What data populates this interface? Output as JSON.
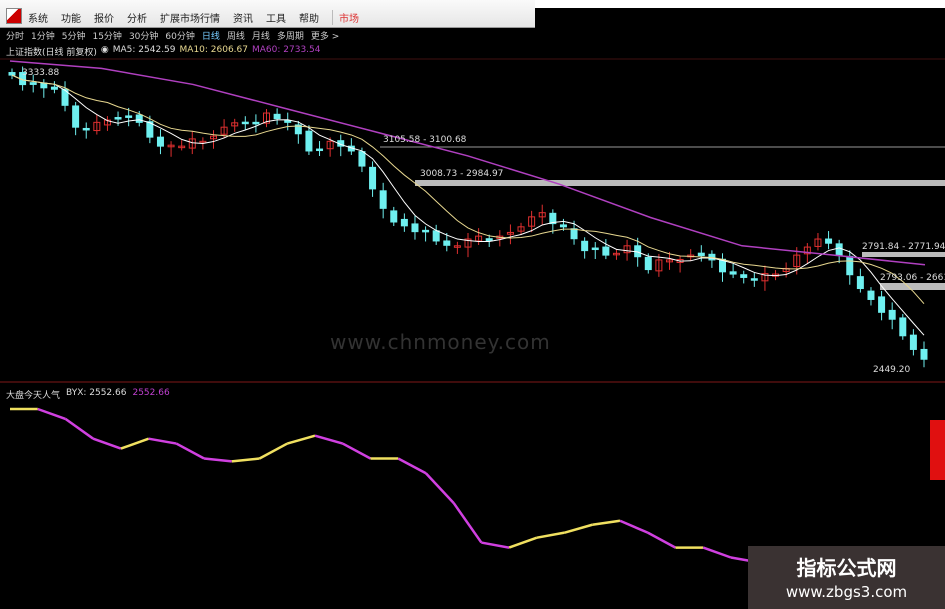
{
  "menu": {
    "items": [
      "系统",
      "功能",
      "报价",
      "分析",
      "扩展市场行情",
      "资讯",
      "工具",
      "帮助"
    ],
    "market": "市场"
  },
  "periods": {
    "items": [
      "分时",
      "1分钟",
      "5分钟",
      "15分钟",
      "30分钟",
      "60分钟",
      "日线",
      "周线",
      "月线",
      "多周期",
      "更多 >"
    ],
    "selected": "日线"
  },
  "info": {
    "name": "上证指数(日线 前复权)",
    "ma5": "MA5: 2542.59",
    "ma10": "MA10: 2606.67",
    "ma60": "MA60: 2733.54"
  },
  "indicator": {
    "name": "大盘今天人气",
    "byx": "BYX: 2552.66",
    "value2": "2552.66"
  },
  "annotations": {
    "high": "3333.88",
    "a1": "3105.58 - 3100.68",
    "a2": "3008.73 - 2984.97",
    "a3": "2791.84 - 2771.94",
    "a4": "2793.06 - 2661",
    "low": "2449.20"
  },
  "watermark": {
    "faint": "www.chnmoney.com",
    "title": "指标公式网",
    "url": "www.zbgs3.com"
  },
  "colors": {
    "up": "#e03030",
    "down": "#6ff0f0",
    "ma5": "#ffffff",
    "ma10": "#e8d890",
    "ma60": "#b040c0",
    "byx_up": "#f0e060",
    "byx_down": "#d040e0"
  },
  "chart_data": {
    "type": "candlestick",
    "ylim": [
      2400,
      3380
    ],
    "closes": [
      3333,
      3304,
      3289,
      3171,
      3186,
      3200,
      3186,
      3112,
      3112,
      3127,
      3171,
      3186,
      3215,
      3186,
      3097,
      3127,
      3097,
      2979,
      2876,
      2846,
      2817,
      2802,
      2832,
      2832,
      2861,
      2905,
      2861,
      2787,
      2773,
      2802,
      2728,
      2758,
      2773,
      2758,
      2714,
      2699,
      2714,
      2773,
      2823,
      2773,
      2669,
      2595,
      2522,
      2449
    ],
    "ma60": [
      3377,
      3354,
      3304,
      3230,
      3156,
      3082,
      2994,
      2890,
      2802,
      2773,
      2743
    ],
    "byx": {
      "ylim": [
        2450,
        3450
      ],
      "values": [
        3400,
        3400,
        3345,
        3235,
        3180,
        3235,
        3208,
        3125,
        3109,
        3125,
        3208,
        3252,
        3208,
        3125,
        3125,
        3043,
        2878,
        2658,
        2630,
        2685,
        2713,
        2757,
        2779,
        2713,
        2630,
        2630,
        2575,
        2548,
        2603,
        2614,
        2600,
        2620,
        2600,
        2552
      ]
    }
  }
}
